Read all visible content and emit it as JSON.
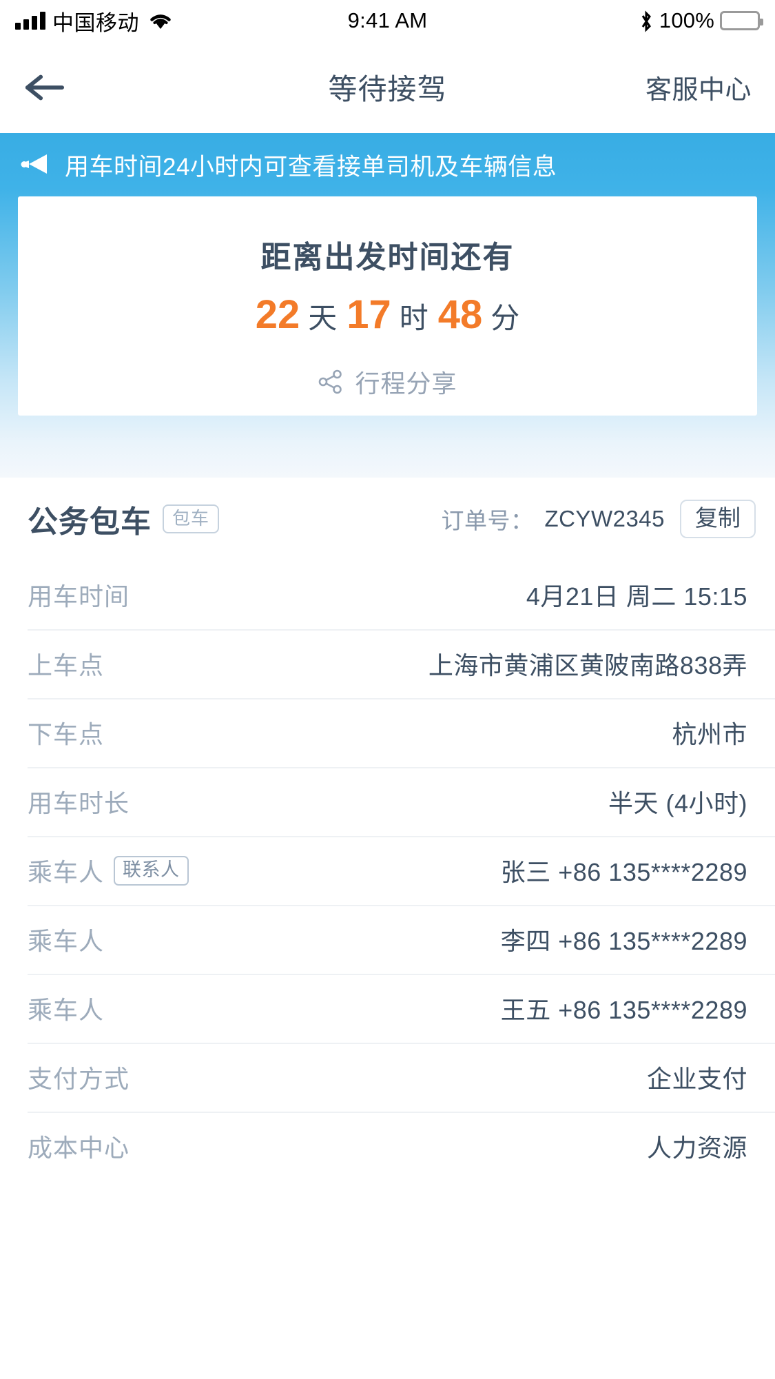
{
  "status_bar": {
    "carrier": "中国移动",
    "time": "9:41 AM",
    "battery_percent": "100%",
    "icons": [
      "signal-bars-icon",
      "wifi-icon",
      "bluetooth-icon",
      "battery-icon"
    ]
  },
  "nav": {
    "back_icon": "arrow-left-icon",
    "title": "等待接驾",
    "action_label": "客服中心"
  },
  "hero": {
    "banner_icon": "megaphone-icon",
    "banner_text": "用车时间24小时内可查看接单司机及车辆信息",
    "countdown_label": "距离出发时间还有",
    "countdown": {
      "days": "22",
      "days_unit": "天",
      "hours": "17",
      "hours_unit": "时",
      "minutes": "48",
      "minutes_unit": "分"
    },
    "share_icon": "share-icon",
    "share_label": "行程分享",
    "accent_color": "#f37b29",
    "banner_color": "#3fb2e8"
  },
  "order": {
    "type_label": "公务包车",
    "type_badge": "包车",
    "order_no_label": "订单号：",
    "order_no_value": "ZCYW2345",
    "copy_label": "复制"
  },
  "details": [
    {
      "label": "用车时间",
      "badge": null,
      "value": "4月21日 周二 15:15"
    },
    {
      "label": "上车点",
      "badge": null,
      "value": "上海市黄浦区黄陂南路838弄"
    },
    {
      "label": "下车点",
      "badge": null,
      "value": "杭州市"
    },
    {
      "label": "用车时长",
      "badge": null,
      "value": "半天 (4小时)"
    },
    {
      "label": "乘车人",
      "badge": "联系人",
      "value": "张三 +86 135****2289"
    },
    {
      "label": "乘车人",
      "badge": null,
      "value": "李四 +86 135****2289"
    },
    {
      "label": "乘车人",
      "badge": null,
      "value": "王五 +86 135****2289"
    },
    {
      "label": "支付方式",
      "badge": null,
      "value": "企业支付"
    },
    {
      "label": "成本中心",
      "badge": null,
      "value": "人力资源"
    }
  ]
}
